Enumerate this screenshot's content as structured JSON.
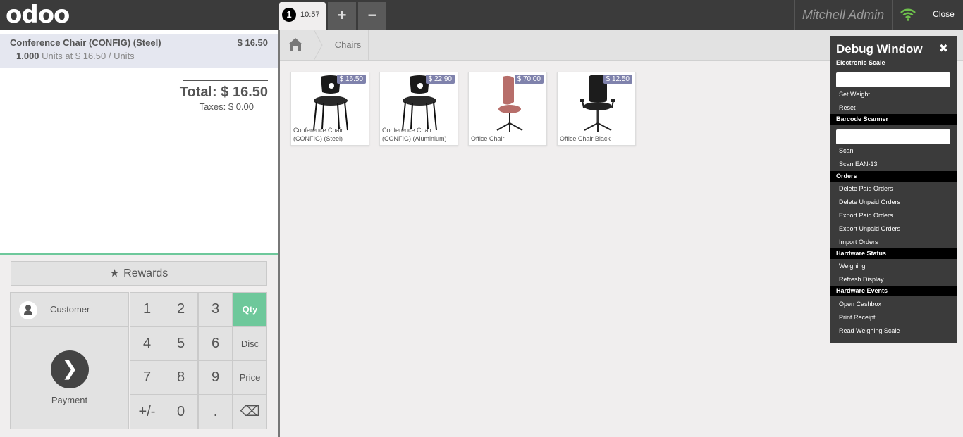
{
  "topbar": {
    "logo": "odoo",
    "order_number": "1",
    "order_time": "10:57",
    "add_label": "+",
    "remove_label": "−",
    "username": "Mitchell Admin",
    "close_label": "Close"
  },
  "order": {
    "line": {
      "product": "Conference Chair (CONFIG) (Steel)",
      "price": "$ 16.50",
      "qty": "1.000",
      "detail": "Units at $ 16.50 / Units"
    },
    "total": "Total: $ 16.50",
    "taxes": "Taxes: $ 0.00"
  },
  "pad": {
    "rewards": "Rewards",
    "customer": "Customer",
    "payment": "Payment",
    "keys": [
      "1",
      "2",
      "3",
      "Qty",
      "4",
      "5",
      "6",
      "Disc",
      "7",
      "8",
      "9",
      "Price",
      "+/-",
      "0",
      ".",
      "⌫"
    ]
  },
  "breadcrumb": {
    "category": "Chairs"
  },
  "products": [
    {
      "name": "Conference Chair (CONFIG) (Steel)",
      "price": "$ 16.50"
    },
    {
      "name": "Conference Chair (CONFIG) (Aluminium)",
      "price": "$ 22.90"
    },
    {
      "name": "Office Chair",
      "price": "$ 70.00"
    },
    {
      "name": "Office Chair Black",
      "price": "$ 12.50"
    }
  ],
  "debug": {
    "title": "Debug Window",
    "close": "✖",
    "sections": {
      "electronic_scale": "Electronic Scale",
      "barcode_scanner": "Barcode Scanner",
      "orders": "Orders",
      "hardware_status": "Hardware Status",
      "hardware_events": "Hardware Events"
    },
    "items": {
      "set_weight": "Set Weight",
      "reset": "Reset",
      "scan": "Scan",
      "scan_ean13": "Scan EAN-13",
      "delete_paid": "Delete Paid Orders",
      "delete_unpaid": "Delete Unpaid Orders",
      "export_paid": "Export Paid Orders",
      "export_unpaid": "Export Unpaid Orders",
      "import_orders": "Import Orders",
      "weighing": "Weighing",
      "refresh_display": "Refresh Display",
      "open_cashbox": "Open Cashbox",
      "print_receipt": "Print Receipt",
      "read_weighing_scale": "Read Weighing Scale"
    }
  },
  "colors": {
    "accent": "#6ec89b",
    "price_tag": "#7f82ac",
    "topbar": "#3b3b3b",
    "wifi": "#6ec04c"
  }
}
